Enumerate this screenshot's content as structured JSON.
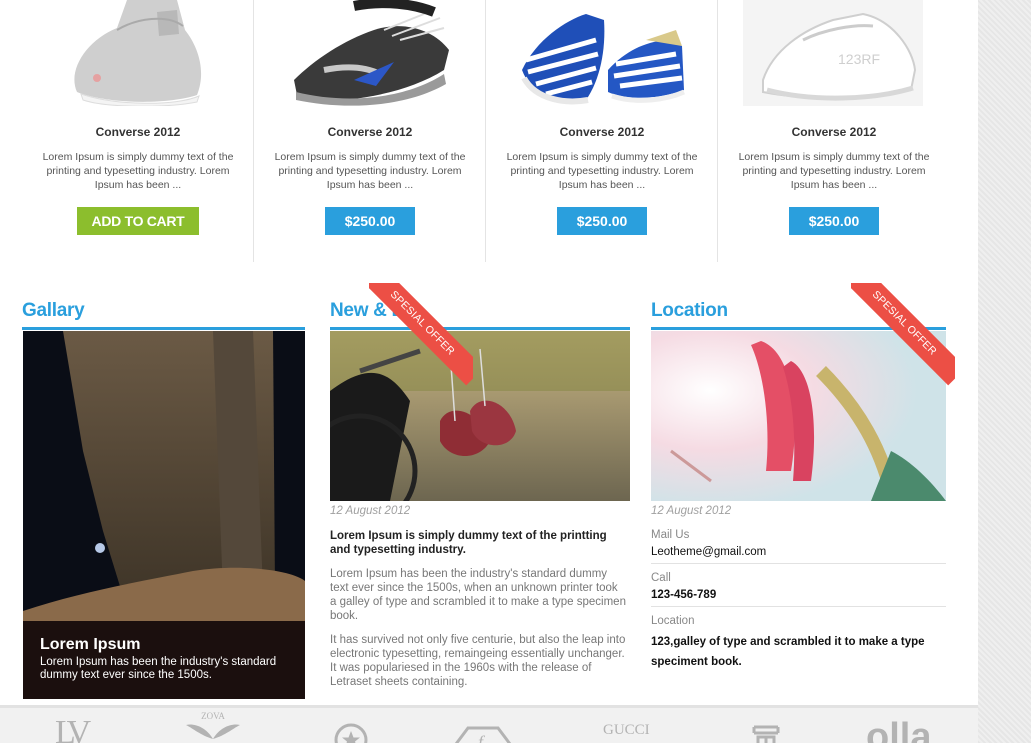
{
  "products": [
    {
      "name": "Converse 2012",
      "description": "Lorem Ipsum is simply dummy text of the printing and typesetting industry. Lorem Ipsum has been ...",
      "button": "ADD TO CART",
      "button_type": "cart",
      "image_icon": "grey-slip-on-shoe-image"
    },
    {
      "name": "Converse 2012",
      "description": "Lorem Ipsum is simply dummy text of the printing and typesetting industry. Lorem Ipsum has been ...",
      "button": "$250.00",
      "button_type": "price",
      "image_icon": "black-running-shoe-image"
    },
    {
      "name": "Converse 2012",
      "description": "Lorem Ipsum is simply dummy text of the printing and typesetting industry. Lorem Ipsum has been ...",
      "button": "$250.00",
      "button_type": "price",
      "image_icon": "blue-striped-shoe-image"
    },
    {
      "name": "Converse 2012",
      "description": "Lorem Ipsum is simply dummy text of the printing and typesetting industry. Lorem Ipsum has been ...",
      "button": "$250.00",
      "button_type": "price",
      "image_icon": "white-sneaker-image"
    }
  ],
  "gallery": {
    "title": "Gallary",
    "caption_title": "Lorem Ipsum",
    "caption_text": "Lorem Ipsum has been the industry's standard dummy text ever since the 1500s."
  },
  "news": {
    "title": "New & Ev",
    "ribbon": "SPESIAL OFFER",
    "date": "12 August 2012",
    "headline": "Lorem Ipsum is simply dummy text of the printting and typesetting industry.",
    "paragraph1": "Lorem Ipsum has been the industry's standard dummy text ever since the 1500s, when an unknown printer took a galley of type and scrambled it to make a type specimen book.",
    "paragraph2": "It has survived not only five centurie, but also the leap into electronic typesetting, remaingeing essentially unchanger. It was populariesed in the 1960s with the release of Letraset sheets containing."
  },
  "location": {
    "title": "Location",
    "ribbon": "SPESIAL OFFER",
    "date": "12 August 2012",
    "mail_label": "Mail Us",
    "mail_value": "Leotheme@gmail.com",
    "call_label": "Call",
    "call_value": "123-456-789",
    "location_label": "Location",
    "location_value": "123,galley of type and scrambled it to make a type speciment book."
  },
  "brands": [
    {
      "name": "LV",
      "icon": "lv-logo"
    },
    {
      "name": "ZOVA",
      "icon": "zova-logo"
    },
    {
      "name": "",
      "icon": "star-circle-logo"
    },
    {
      "name": "f",
      "icon": "fendi-style-logo"
    },
    {
      "name": "GUCCI",
      "icon": "gucci-logo"
    },
    {
      "name": "",
      "icon": "square-glyph-logo"
    },
    {
      "name": "olla",
      "icon": "olla-logo"
    }
  ],
  "colors": {
    "accent_blue": "#2a9fdd",
    "cart_green": "#8cbe2d",
    "ribbon_red": "#ec4f45"
  }
}
